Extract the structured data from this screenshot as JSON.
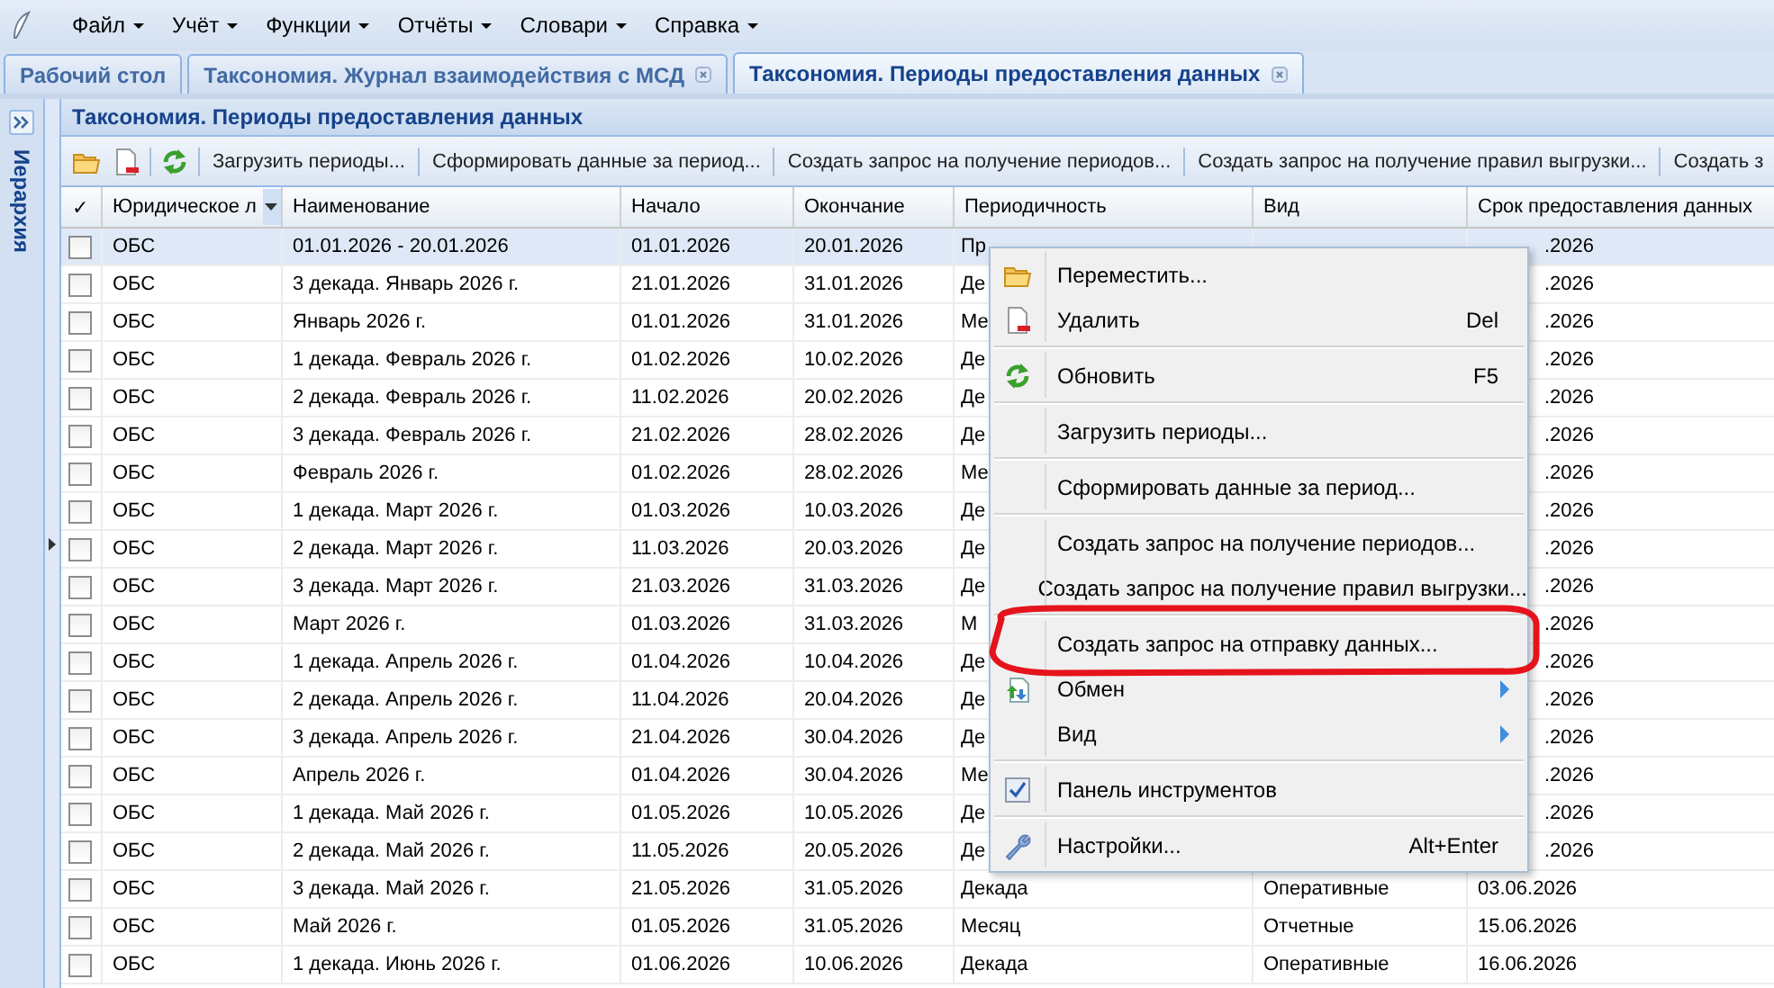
{
  "menu_bar": {
    "items": [
      "Файл",
      "Учёт",
      "Функции",
      "Отчёты",
      "Словари",
      "Справка"
    ]
  },
  "tabs": [
    {
      "label": "Рабочий стол",
      "selected": false,
      "closable": false
    },
    {
      "label": "Таксономия. Журнал взаимодействия с МСД",
      "selected": false,
      "closable": true
    },
    {
      "label": "Таксономия. Периоды предоставления данных",
      "selected": true,
      "closable": true
    }
  ],
  "side_panel": {
    "title": "Иерархия",
    "collapsed": true
  },
  "panel": {
    "title": "Таксономия. Периоды предоставления данных"
  },
  "toolbar": {
    "buttons": [
      "Загрузить периоды...",
      "Сформировать данные за период...",
      "Создать запрос на получение периодов...",
      "Создать запрос на получение правил выгрузки...",
      "Создать з"
    ]
  },
  "table": {
    "columns": [
      "✓",
      "Юридическое л",
      "Наименование",
      "Начало",
      "Окончание",
      "Периодичность",
      "Вид",
      "Срок предоставления данных"
    ],
    "rows": [
      {
        "checked": false,
        "selected": true,
        "legal_entity": "ОБС",
        "name": "01.01.2026 - 20.01.2026",
        "start": "01.01.2026",
        "end": "20.01.2026",
        "periodicity": "Пр",
        "deadline": ".2026"
      },
      {
        "checked": false,
        "selected": false,
        "legal_entity": "ОБС",
        "name": "3 декада. Январь 2026 г.",
        "start": "21.01.2026",
        "end": "31.01.2026",
        "periodicity": "Де",
        "deadline": ".2026"
      },
      {
        "checked": false,
        "selected": false,
        "legal_entity": "ОБС",
        "name": "Январь 2026 г.",
        "start": "01.01.2026",
        "end": "31.01.2026",
        "periodicity": "Ме",
        "deadline": ".2026"
      },
      {
        "checked": false,
        "selected": false,
        "legal_entity": "ОБС",
        "name": "1 декада. Февраль 2026 г.",
        "start": "01.02.2026",
        "end": "10.02.2026",
        "periodicity": "Де",
        "deadline": ".2026"
      },
      {
        "checked": false,
        "selected": false,
        "legal_entity": "ОБС",
        "name": "2 декада. Февраль 2026 г.",
        "start": "11.02.2026",
        "end": "20.02.2026",
        "periodicity": "Де",
        "deadline": ".2026"
      },
      {
        "checked": false,
        "selected": false,
        "legal_entity": "ОБС",
        "name": "3 декада. Февраль 2026 г.",
        "start": "21.02.2026",
        "end": "28.02.2026",
        "periodicity": "Де",
        "deadline": ".2026"
      },
      {
        "checked": false,
        "selected": false,
        "legal_entity": "ОБС",
        "name": "Февраль 2026 г.",
        "start": "01.02.2026",
        "end": "28.02.2026",
        "periodicity": "Ме",
        "deadline": ".2026"
      },
      {
        "checked": false,
        "selected": false,
        "legal_entity": "ОБС",
        "name": "1 декада. Март 2026 г.",
        "start": "01.03.2026",
        "end": "10.03.2026",
        "periodicity": "Де",
        "deadline": ".2026"
      },
      {
        "checked": false,
        "selected": false,
        "legal_entity": "ОБС",
        "name": "2 декада. Март 2026 г.",
        "start": "11.03.2026",
        "end": "20.03.2026",
        "periodicity": "Де",
        "deadline": ".2026"
      },
      {
        "checked": false,
        "selected": false,
        "legal_entity": "ОБС",
        "name": "3 декада. Март 2026 г.",
        "start": "21.03.2026",
        "end": "31.03.2026",
        "periodicity": "Де",
        "deadline": ".2026"
      },
      {
        "checked": false,
        "selected": false,
        "legal_entity": "ОБС",
        "name": "Март 2026 г.",
        "start": "01.03.2026",
        "end": "31.03.2026",
        "periodicity": "М",
        "deadline": ".2026"
      },
      {
        "checked": false,
        "selected": false,
        "legal_entity": "ОБС",
        "name": "1 декада. Апрель 2026 г.",
        "start": "01.04.2026",
        "end": "10.04.2026",
        "periodicity": "Де",
        "deadline": ".2026"
      },
      {
        "checked": false,
        "selected": false,
        "legal_entity": "ОБС",
        "name": "2 декада. Апрель 2026 г.",
        "start": "11.04.2026",
        "end": "20.04.2026",
        "periodicity": "Де",
        "deadline": ".2026"
      },
      {
        "checked": false,
        "selected": false,
        "legal_entity": "ОБС",
        "name": "3 декада. Апрель 2026 г.",
        "start": "21.04.2026",
        "end": "30.04.2026",
        "periodicity": "Де",
        "deadline": ".2026"
      },
      {
        "checked": false,
        "selected": false,
        "legal_entity": "ОБС",
        "name": "Апрель 2026 г.",
        "start": "01.04.2026",
        "end": "30.04.2026",
        "periodicity": "Ме",
        "deadline": ".2026"
      },
      {
        "checked": false,
        "selected": false,
        "legal_entity": "ОБС",
        "name": "1 декада. Май 2026 г.",
        "start": "01.05.2026",
        "end": "10.05.2026",
        "periodicity": "Де",
        "deadline": ".2026"
      },
      {
        "checked": false,
        "selected": false,
        "legal_entity": "ОБС",
        "name": "2 декада. Май 2026 г.",
        "start": "11.05.2026",
        "end": "20.05.2026",
        "periodicity": "Де",
        "deadline": ".2026"
      },
      {
        "checked": false,
        "selected": false,
        "legal_entity": "ОБС",
        "name": "3 декада. Май 2026 г.",
        "start": "21.05.2026",
        "end": "31.05.2026",
        "periodicity": "Декада",
        "type": "Оперативные",
        "deadline": "03.06.2026"
      },
      {
        "checked": false,
        "selected": false,
        "legal_entity": "ОБС",
        "name": "Май 2026 г.",
        "start": "01.05.2026",
        "end": "31.05.2026",
        "periodicity": "Месяц",
        "type": "Отчетные",
        "deadline": "15.06.2026"
      },
      {
        "checked": false,
        "selected": false,
        "legal_entity": "ОБС",
        "name": "1 декада. Июнь 2026 г.",
        "start": "01.06.2026",
        "end": "10.06.2026",
        "periodicity": "Декада",
        "type": "Оперативные",
        "deadline": "16.06.2026"
      }
    ]
  },
  "context_menu": {
    "items": [
      {
        "kind": "item",
        "label": "Переместить..."
      },
      {
        "kind": "item",
        "label": "Удалить",
        "shortcut": "Del"
      },
      {
        "kind": "separator"
      },
      {
        "kind": "item",
        "label": "Обновить",
        "shortcut": "F5"
      },
      {
        "kind": "separator"
      },
      {
        "kind": "item",
        "label": "Загрузить периоды..."
      },
      {
        "kind": "separator"
      },
      {
        "kind": "item",
        "label": "Сформировать данные за период..."
      },
      {
        "kind": "separator"
      },
      {
        "kind": "item",
        "label": "Создать запрос на получение периодов..."
      },
      {
        "kind": "item",
        "label": "Создать запрос на получение правил выгрузки..."
      },
      {
        "kind": "separator"
      },
      {
        "kind": "item",
        "label": "Создать запрос на отправку данных...",
        "circled": true
      },
      {
        "kind": "submenu",
        "label": "Обмен"
      },
      {
        "kind": "submenu",
        "label": "Вид"
      },
      {
        "kind": "separator"
      },
      {
        "kind": "check",
        "label": "Панель инструментов",
        "checked": true
      },
      {
        "kind": "separator"
      },
      {
        "kind": "item",
        "label": "Настройки...",
        "shortcut": "Alt+Enter"
      }
    ]
  }
}
